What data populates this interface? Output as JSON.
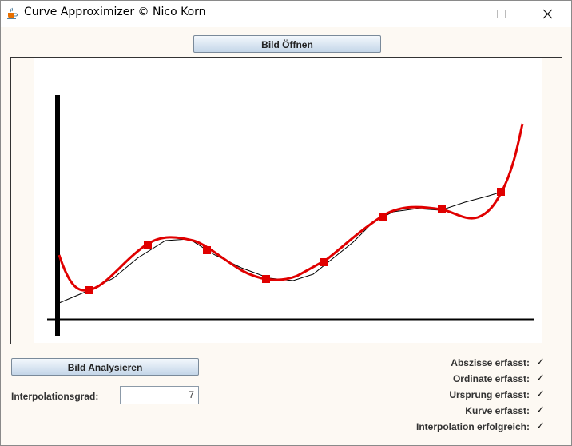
{
  "window": {
    "title": "Curve Approximizer © Nico Korn",
    "icon": "java-cup-icon"
  },
  "toolbar": {
    "open_label": "Bild Öffnen",
    "analyze_label": "Bild Analysieren"
  },
  "interpolation": {
    "label": "Interpolationsgrad:",
    "value": "7"
  },
  "status": [
    {
      "label": "Abszisse erfasst:",
      "check": "✓"
    },
    {
      "label": "Ordinate erfasst:",
      "check": "✓"
    },
    {
      "label": "Ursprung erfasst:",
      "check": "✓"
    },
    {
      "label": "Kurve erfasst:",
      "check": "✓"
    },
    {
      "label": "Interpolation erfolgreich:",
      "check": "✓"
    }
  ],
  "colors": {
    "curve": "#e00000",
    "points": "#e00000",
    "axes": "#000000",
    "original_curve": "#000000"
  }
}
